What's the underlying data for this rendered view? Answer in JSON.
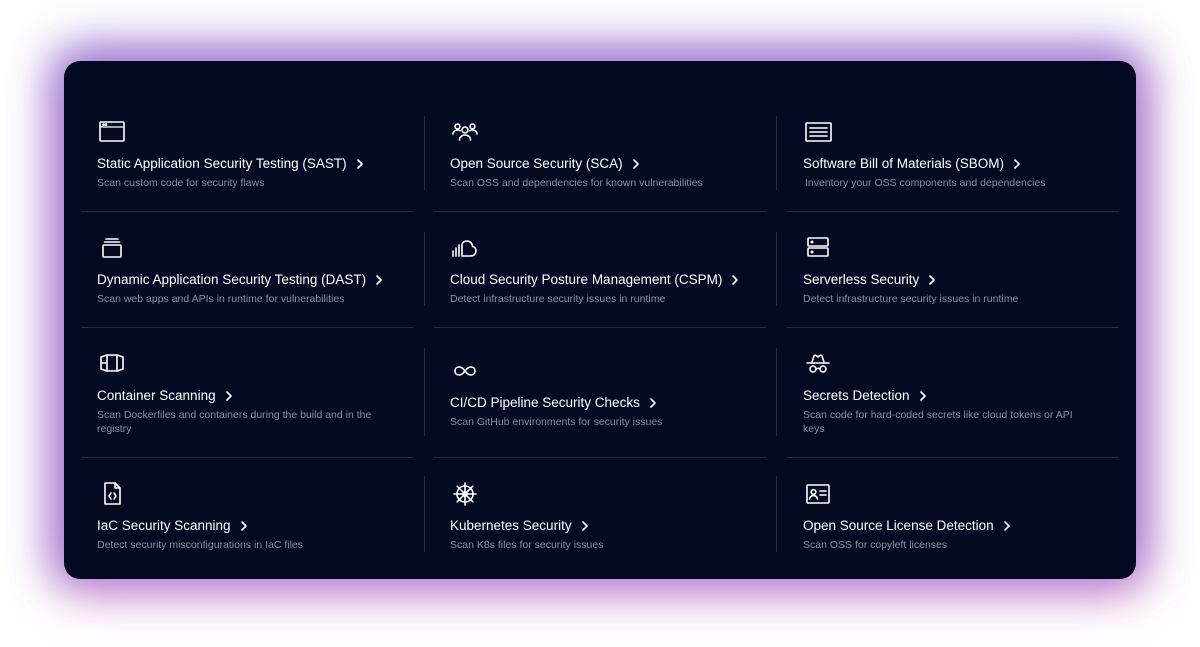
{
  "products": [
    {
      "icon": "browser-window-icon",
      "title": "Static Application Security Testing (SAST)",
      "description": "Scan custom code for security flaws"
    },
    {
      "icon": "people-group-icon",
      "title": "Open Source Security (SCA)",
      "description": "Scan OSS and dependencies for known vulnerabilities"
    },
    {
      "icon": "document-list-icon",
      "title": "Software Bill of Materials (SBOM)",
      "description": "Inventory your OSS components and dependencies"
    },
    {
      "icon": "layers-stack-icon",
      "title": "Dynamic Application Security Testing (DAST)",
      "description": "Scan web apps and APIs in runtime for vulnerabilities"
    },
    {
      "icon": "cloud-signal-icon",
      "title": "Cloud Security Posture Management (CSPM)",
      "description": "Detect infrastructure security issues in runtime"
    },
    {
      "icon": "server-icon",
      "title": "Serverless Security",
      "description": "Detect infrastructure security issues in runtime"
    },
    {
      "icon": "container-box-icon",
      "title": "Container Scanning",
      "description": "Scan Dockerfiles and containers during the build and in the registry"
    },
    {
      "icon": "infinity-icon",
      "title": "CI/CD Pipeline Security Checks",
      "description": "Scan GitHub environments for security issues"
    },
    {
      "icon": "spy-incognito-icon",
      "title": "Secrets Detection",
      "description": "Scan code for hard-coded secrets like cloud tokens or API keys"
    },
    {
      "icon": "code-file-icon",
      "title": "IaC Security Scanning",
      "description": "Detect security misconfigurations in IaC files"
    },
    {
      "icon": "kubernetes-helm-icon",
      "title": "Kubernetes Security",
      "description": "Scan K8s files for security issues"
    },
    {
      "icon": "id-card-icon",
      "title": "Open Source License Detection",
      "description": "Scan OSS for copyleft licenses"
    }
  ]
}
